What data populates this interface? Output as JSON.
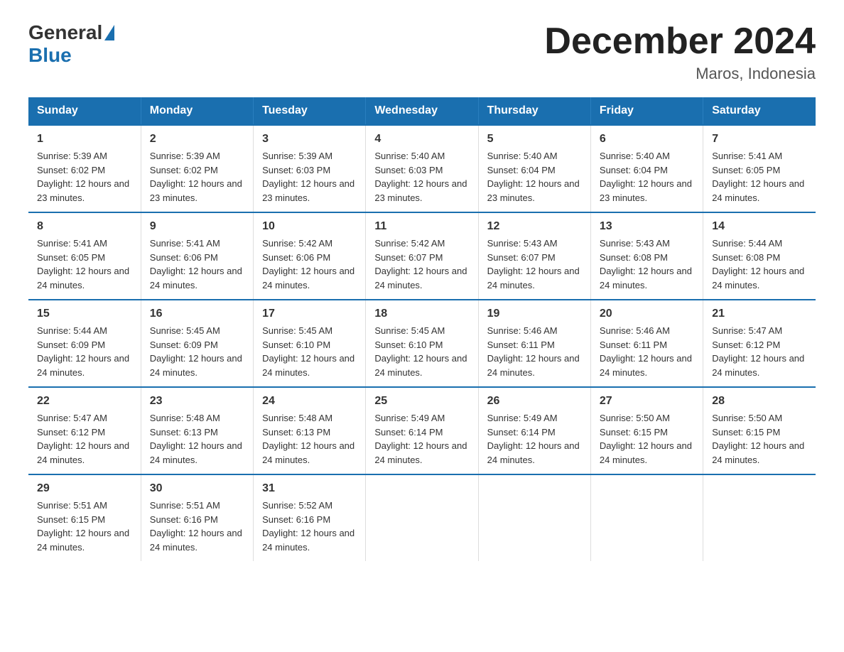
{
  "header": {
    "logo_general": "General",
    "logo_blue": "Blue",
    "title": "December 2024",
    "subtitle": "Maros, Indonesia"
  },
  "days_of_week": [
    "Sunday",
    "Monday",
    "Tuesday",
    "Wednesday",
    "Thursday",
    "Friday",
    "Saturday"
  ],
  "weeks": [
    [
      {
        "day": "1",
        "sunrise": "5:39 AM",
        "sunset": "6:02 PM",
        "daylight": "12 hours and 23 minutes."
      },
      {
        "day": "2",
        "sunrise": "5:39 AM",
        "sunset": "6:02 PM",
        "daylight": "12 hours and 23 minutes."
      },
      {
        "day": "3",
        "sunrise": "5:39 AM",
        "sunset": "6:03 PM",
        "daylight": "12 hours and 23 minutes."
      },
      {
        "day": "4",
        "sunrise": "5:40 AM",
        "sunset": "6:03 PM",
        "daylight": "12 hours and 23 minutes."
      },
      {
        "day": "5",
        "sunrise": "5:40 AM",
        "sunset": "6:04 PM",
        "daylight": "12 hours and 23 minutes."
      },
      {
        "day": "6",
        "sunrise": "5:40 AM",
        "sunset": "6:04 PM",
        "daylight": "12 hours and 23 minutes."
      },
      {
        "day": "7",
        "sunrise": "5:41 AM",
        "sunset": "6:05 PM",
        "daylight": "12 hours and 24 minutes."
      }
    ],
    [
      {
        "day": "8",
        "sunrise": "5:41 AM",
        "sunset": "6:05 PM",
        "daylight": "12 hours and 24 minutes."
      },
      {
        "day": "9",
        "sunrise": "5:41 AM",
        "sunset": "6:06 PM",
        "daylight": "12 hours and 24 minutes."
      },
      {
        "day": "10",
        "sunrise": "5:42 AM",
        "sunset": "6:06 PM",
        "daylight": "12 hours and 24 minutes."
      },
      {
        "day": "11",
        "sunrise": "5:42 AM",
        "sunset": "6:07 PM",
        "daylight": "12 hours and 24 minutes."
      },
      {
        "day": "12",
        "sunrise": "5:43 AM",
        "sunset": "6:07 PM",
        "daylight": "12 hours and 24 minutes."
      },
      {
        "day": "13",
        "sunrise": "5:43 AM",
        "sunset": "6:08 PM",
        "daylight": "12 hours and 24 minutes."
      },
      {
        "day": "14",
        "sunrise": "5:44 AM",
        "sunset": "6:08 PM",
        "daylight": "12 hours and 24 minutes."
      }
    ],
    [
      {
        "day": "15",
        "sunrise": "5:44 AM",
        "sunset": "6:09 PM",
        "daylight": "12 hours and 24 minutes."
      },
      {
        "day": "16",
        "sunrise": "5:45 AM",
        "sunset": "6:09 PM",
        "daylight": "12 hours and 24 minutes."
      },
      {
        "day": "17",
        "sunrise": "5:45 AM",
        "sunset": "6:10 PM",
        "daylight": "12 hours and 24 minutes."
      },
      {
        "day": "18",
        "sunrise": "5:45 AM",
        "sunset": "6:10 PM",
        "daylight": "12 hours and 24 minutes."
      },
      {
        "day": "19",
        "sunrise": "5:46 AM",
        "sunset": "6:11 PM",
        "daylight": "12 hours and 24 minutes."
      },
      {
        "day": "20",
        "sunrise": "5:46 AM",
        "sunset": "6:11 PM",
        "daylight": "12 hours and 24 minutes."
      },
      {
        "day": "21",
        "sunrise": "5:47 AM",
        "sunset": "6:12 PM",
        "daylight": "12 hours and 24 minutes."
      }
    ],
    [
      {
        "day": "22",
        "sunrise": "5:47 AM",
        "sunset": "6:12 PM",
        "daylight": "12 hours and 24 minutes."
      },
      {
        "day": "23",
        "sunrise": "5:48 AM",
        "sunset": "6:13 PM",
        "daylight": "12 hours and 24 minutes."
      },
      {
        "day": "24",
        "sunrise": "5:48 AM",
        "sunset": "6:13 PM",
        "daylight": "12 hours and 24 minutes."
      },
      {
        "day": "25",
        "sunrise": "5:49 AM",
        "sunset": "6:14 PM",
        "daylight": "12 hours and 24 minutes."
      },
      {
        "day": "26",
        "sunrise": "5:49 AM",
        "sunset": "6:14 PM",
        "daylight": "12 hours and 24 minutes."
      },
      {
        "day": "27",
        "sunrise": "5:50 AM",
        "sunset": "6:15 PM",
        "daylight": "12 hours and 24 minutes."
      },
      {
        "day": "28",
        "sunrise": "5:50 AM",
        "sunset": "6:15 PM",
        "daylight": "12 hours and 24 minutes."
      }
    ],
    [
      {
        "day": "29",
        "sunrise": "5:51 AM",
        "sunset": "6:15 PM",
        "daylight": "12 hours and 24 minutes."
      },
      {
        "day": "30",
        "sunrise": "5:51 AM",
        "sunset": "6:16 PM",
        "daylight": "12 hours and 24 minutes."
      },
      {
        "day": "31",
        "sunrise": "5:52 AM",
        "sunset": "6:16 PM",
        "daylight": "12 hours and 24 minutes."
      },
      {
        "day": "",
        "sunrise": "",
        "sunset": "",
        "daylight": ""
      },
      {
        "day": "",
        "sunrise": "",
        "sunset": "",
        "daylight": ""
      },
      {
        "day": "",
        "sunrise": "",
        "sunset": "",
        "daylight": ""
      },
      {
        "day": "",
        "sunrise": "",
        "sunset": "",
        "daylight": ""
      }
    ]
  ],
  "labels": {
    "sunrise_prefix": "Sunrise: ",
    "sunset_prefix": "Sunset: ",
    "daylight_prefix": "Daylight: "
  }
}
